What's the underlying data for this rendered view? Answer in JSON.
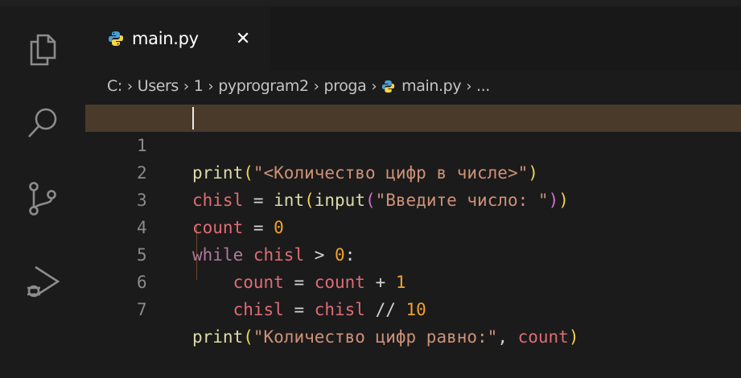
{
  "editor_tab": {
    "label": "main.py",
    "close_glyph": "✕",
    "icon": "python-icon"
  },
  "breadcrumb": [
    "C:",
    "Users",
    "1",
    "pyprogram2",
    "proga",
    "main.py",
    "..."
  ],
  "activity_icons": [
    "explorer-icon",
    "search-icon",
    "source-control-icon",
    "run-debug-icon"
  ],
  "code": {
    "line_numbers": [
      "1",
      "2",
      "3",
      "4",
      "5",
      "6",
      "7"
    ],
    "l1": {
      "fn": "print",
      "open": "(",
      "str": "\"<Количество цифр в числе>\"",
      "close": ")"
    },
    "l2": {
      "var": "chisl",
      "eq": " = ",
      "fn1": "int",
      "p1": "(",
      "fn2": "input",
      "p2": "(",
      "str": "\"Введите число: \"",
      "p2c": ")",
      "p1c": ")"
    },
    "l3": {
      "var": "count",
      "eq": " = ",
      "num": "0"
    },
    "l4": {
      "kw": "while",
      "var": "chisl",
      "op": " > ",
      "num": "0",
      "colon": ":"
    },
    "l5": {
      "var": "count",
      "eq": " = ",
      "var2": "count",
      "op": " + ",
      "num": "1"
    },
    "l6": {
      "var": "chisl",
      "eq": " = ",
      "var2": "chisl",
      "op": " // ",
      "num": "10"
    },
    "l7": {
      "fn": "print",
      "open": "(",
      "str": "\"Количество цифр равно:\"",
      "comma": ", ",
      "var": "count",
      "close": ")"
    }
  },
  "colors": {
    "background": "#1b1b1b",
    "active_line": "#4a3a2a",
    "function": "#dcdcaa",
    "string": "#ce9178",
    "variable": "#e06c75",
    "number": "#f0a030",
    "keyword": "#b07898"
  }
}
